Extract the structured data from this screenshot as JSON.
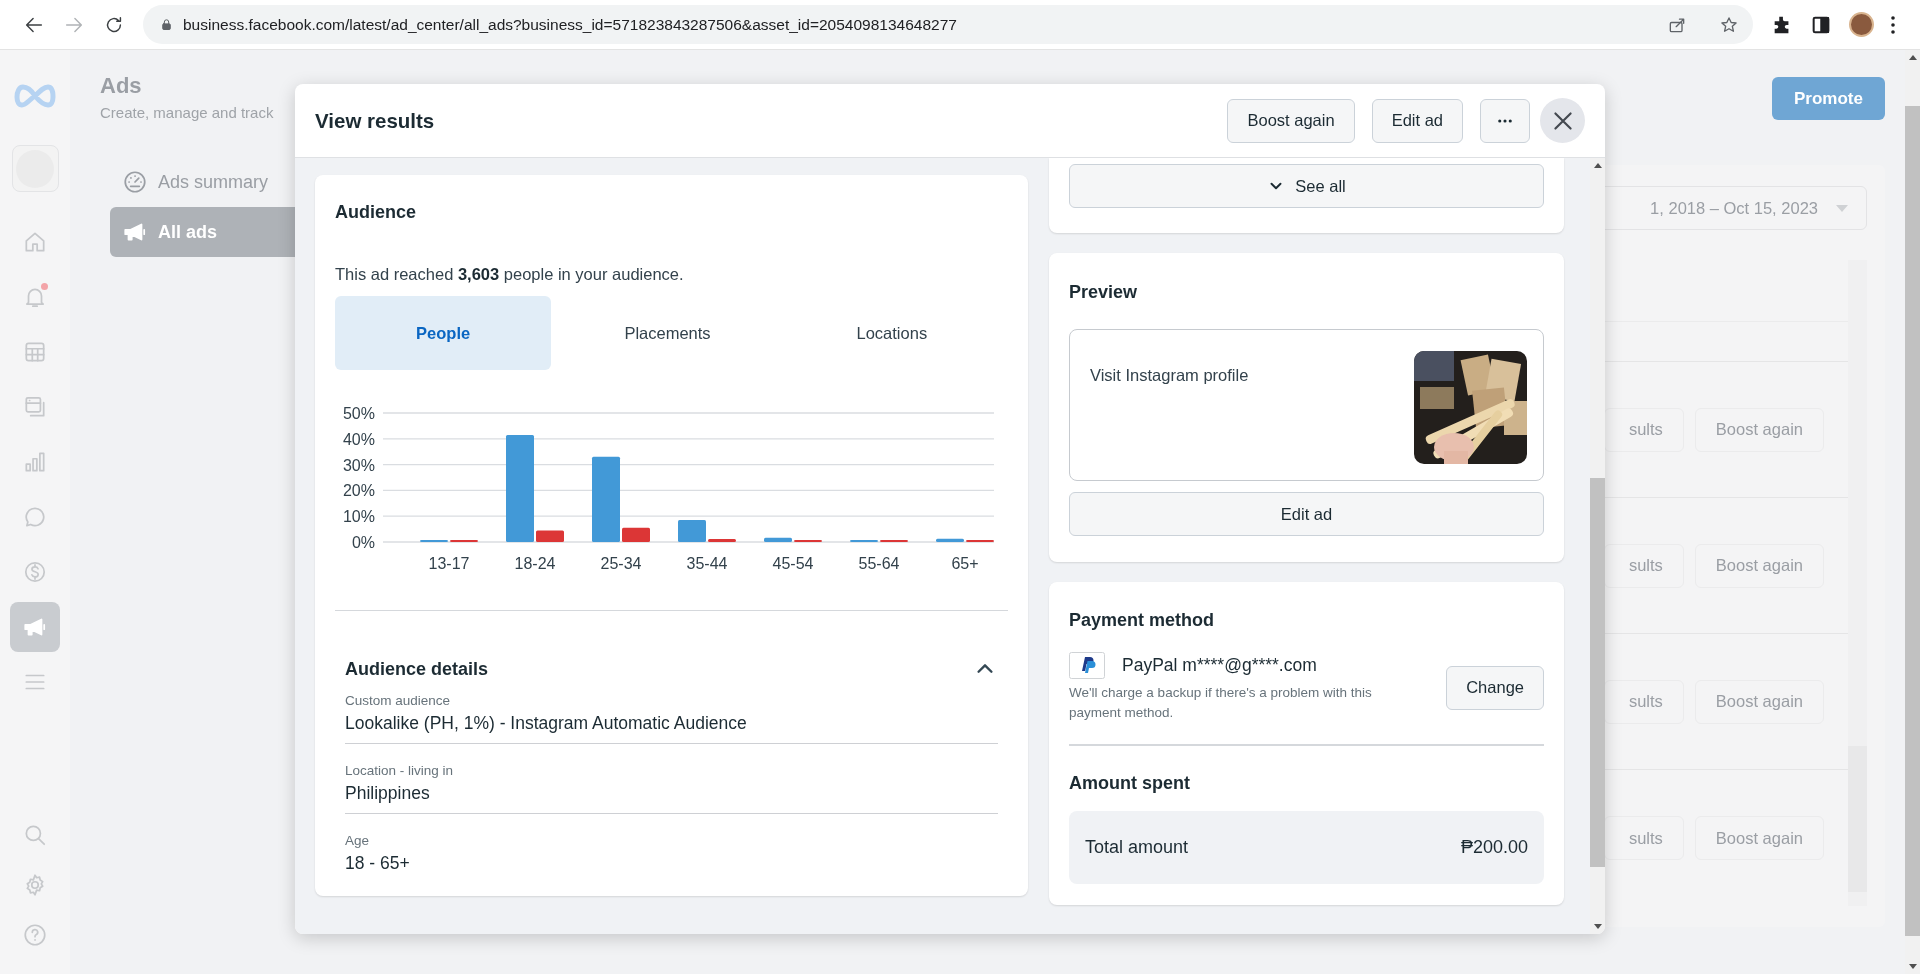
{
  "browser": {
    "url": "business.facebook.com/latest/ad_center/all_ads?business_id=571823843287506&asset_id=2054098134648277",
    "nav_buttons": [
      {
        "kind": "back",
        "disabled": false
      },
      {
        "kind": "forward",
        "disabled": true
      },
      {
        "kind": "reload",
        "disabled": false
      }
    ]
  },
  "rail": {
    "items": [
      {
        "kind": "home",
        "selected": false,
        "badge": false
      },
      {
        "kind": "bell",
        "selected": false,
        "badge": true
      },
      {
        "kind": "table",
        "selected": false,
        "badge": false
      },
      {
        "kind": "pages",
        "selected": false,
        "badge": false
      },
      {
        "kind": "chart",
        "selected": false,
        "badge": false
      },
      {
        "kind": "chat",
        "selected": false,
        "badge": false
      },
      {
        "kind": "dollar",
        "selected": false,
        "badge": false
      },
      {
        "kind": "megaphone",
        "selected": true,
        "badge": false
      },
      {
        "kind": "menu",
        "selected": false,
        "badge": false
      }
    ]
  },
  "ads_nav": {
    "title": "Ads",
    "subtitle": "Create, manage and track",
    "items": [
      {
        "kind": "gauge",
        "label": "Ads summary",
        "selected": false
      },
      {
        "kind": "megaphone",
        "label": "All ads",
        "selected": true
      }
    ]
  },
  "background": {
    "promote": "Promote",
    "date_range": "1, 2018 – Oct 15, 2023",
    "rows": [
      {
        "results": "sults",
        "boost": "Boost again"
      },
      {
        "results": "sults",
        "boost": "Boost again"
      },
      {
        "results": "sults",
        "boost": "Boost again"
      },
      {
        "results": "sults",
        "boost": "Boost again"
      }
    ]
  },
  "modal": {
    "title": "View results",
    "actions": [
      "Boost again",
      "Edit ad"
    ],
    "audience": {
      "title": "Audience",
      "reach": "This ad reached **3,603** people in your audience.",
      "tabs": [
        {
          "label": "People",
          "selected": true
        },
        {
          "label": "Placements",
          "selected": false
        },
        {
          "label": "Locations",
          "selected": false
        }
      ],
      "chart_data": {
        "type": "bar",
        "categories": [
          "13-17",
          "18-24",
          "25-34",
          "35-44",
          "45-54",
          "55-64",
          "65+"
        ],
        "series": [
          {
            "color": "#4299d7",
            "values": [
              0.8,
              41.5,
              33,
              8.5,
              1.6,
              0.8,
              1.3
            ]
          },
          {
            "color": "#dc3636",
            "values": [
              0.8,
              4.5,
              5.5,
              1.2,
              0.8,
              0.8,
              0.8
            ]
          }
        ],
        "grid": true,
        "ylim": [
          0,
          50
        ],
        "yticks": [
          {
            "value": 0,
            "label": "0%"
          },
          {
            "value": 10,
            "label": "10%"
          },
          {
            "value": 20,
            "label": "20%"
          },
          {
            "value": 30,
            "label": "30%"
          },
          {
            "value": 40,
            "label": "40%"
          },
          {
            "value": 50,
            "label": "50%"
          }
        ]
      },
      "details": {
        "title": "Audience details",
        "expanded": true,
        "fields": [
          {
            "label": "Custom audience",
            "value": "Lookalike (PH, 1%) - Instagram Automatic Audience"
          },
          {
            "label": "Location - living in",
            "value": "Philippines"
          },
          {
            "label": "Age",
            "value": "18 - 65+"
          }
        ]
      }
    },
    "see_all": "See all",
    "preview": {
      "title": "Preview",
      "text": "Visit Instagram profile",
      "button": "Edit ad"
    },
    "payment": {
      "title": "Payment method",
      "method": "PayPal m****@g****.com",
      "note": "We'll charge a backup if there's a problem with this payment method.",
      "button": "Change"
    },
    "amount": {
      "title": "Amount spent",
      "label": "Total amount",
      "value": "₱200.00"
    }
  }
}
